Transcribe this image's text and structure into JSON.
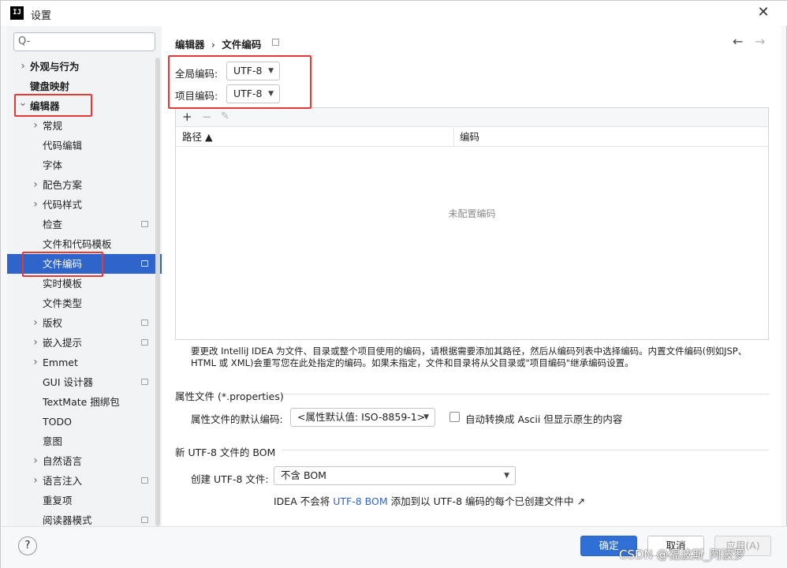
{
  "window": {
    "title": "设置",
    "app_icon_text": "IJ"
  },
  "sidebar": {
    "search": {
      "placeholder": "Q-"
    },
    "items": [
      {
        "label": "外观与行为",
        "expandable": true,
        "expanded": false,
        "bold": true,
        "level": 0
      },
      {
        "label": "键盘映射",
        "expandable": false,
        "bold": true,
        "level": 0
      },
      {
        "label": "编辑器",
        "expandable": true,
        "expanded": true,
        "bold": true,
        "level": 0
      },
      {
        "label": "常规",
        "expandable": true,
        "level": 1
      },
      {
        "label": "代码编辑",
        "level": 1
      },
      {
        "label": "字体",
        "level": 1
      },
      {
        "label": "配色方案",
        "expandable": true,
        "level": 1
      },
      {
        "label": "代码样式",
        "expandable": true,
        "level": 1
      },
      {
        "label": "检查",
        "level": 1,
        "icon": true
      },
      {
        "label": "文件和代码模板",
        "level": 1
      },
      {
        "label": "文件编码",
        "level": 1,
        "icon": true,
        "selected": true
      },
      {
        "label": "实时模板",
        "level": 1
      },
      {
        "label": "文件类型",
        "level": 1
      },
      {
        "label": "版权",
        "expandable": true,
        "level": 1,
        "icon": true
      },
      {
        "label": "嵌入提示",
        "expandable": true,
        "level": 1,
        "icon": true
      },
      {
        "label": "Emmet",
        "expandable": true,
        "level": 1
      },
      {
        "label": "GUI 设计器",
        "level": 1,
        "icon": true
      },
      {
        "label": "TextMate 捆绑包",
        "level": 1
      },
      {
        "label": "TODO",
        "level": 1
      },
      {
        "label": "意图",
        "level": 1
      },
      {
        "label": "自然语言",
        "expandable": true,
        "level": 1
      },
      {
        "label": "语言注入",
        "expandable": true,
        "level": 1,
        "icon": true
      },
      {
        "label": "重复项",
        "level": 1
      },
      {
        "label": "阅读器模式",
        "level": 1,
        "icon": true
      }
    ]
  },
  "main": {
    "breadcrumb": {
      "parent": "编辑器",
      "separator": "›",
      "current": "文件编码"
    },
    "global_encoding": {
      "label": "全局编码:",
      "value": "UTF-8"
    },
    "project_encoding": {
      "label": "项目编码:",
      "value": "UTF-8"
    },
    "table": {
      "toolbar": {
        "add": "+",
        "remove": "−",
        "edit": "✎"
      },
      "columns": [
        "路径 ▲",
        "编码"
      ],
      "empty_text": "未配置编码"
    },
    "note": "要更改 IntelliJ IDEA 为文件、目录或整个项目使用的编码，请根据需要添加其路径，然后从编码列表中选择编码。内置文件编码(例如JSP、HTML 或 XML)会重写您在此处指定的编码。如果未指定，文件和目录将从父目录或\"项目编码\"继承编码设置。",
    "properties": {
      "section_title": "属性文件 (*.properties)",
      "default_encoding_label": "属性文件的默认编码:",
      "default_encoding_value": "<属性默认值: ISO-8859-1>",
      "ascii_checkbox_label": "自动转换成 Ascii 但显示原生的内容",
      "ascii_checkbox_checked": false
    },
    "bom": {
      "section_title": "新 UTF-8 文件的 BOM",
      "create_label": "创建 UTF-8 文件:",
      "create_value": "不含 BOM",
      "info_prefix": "IDEA 不会将",
      "info_link": "UTF-8 BOM",
      "info_suffix": "添加到以 UTF-8 编码的每个已创建文件中 ↗"
    }
  },
  "footer": {
    "help": "?",
    "ok": "确定",
    "cancel": "取消",
    "apply": "应用(A)",
    "watermark": "CSDN @福波斯_阿波罗"
  },
  "colors": {
    "selection": "#2f65ca",
    "highlight": "#e53935",
    "link": "#2f65ca",
    "ok_button": "#2f6fd6"
  }
}
